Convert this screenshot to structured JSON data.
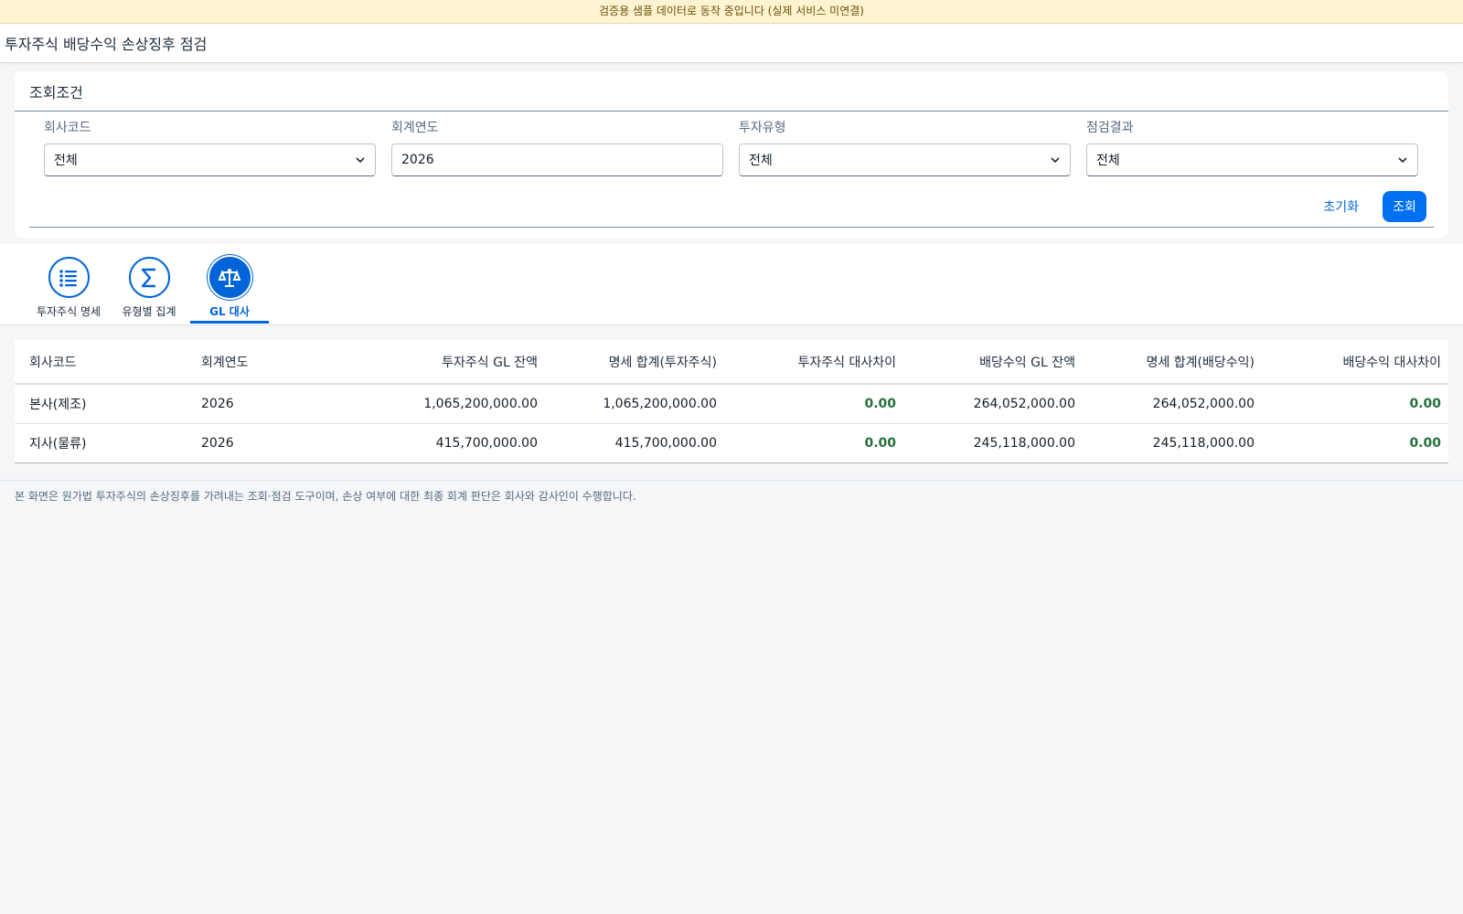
{
  "banner": "검증용 샘플 데이터로 동작 중입니다 (실제 서비스 미연결)",
  "page_title": "투자주식 배당수익 손상징후 점검",
  "filter": {
    "title": "조회조건",
    "fields": [
      {
        "label": "회사코드",
        "value": "전체",
        "type": "select"
      },
      {
        "label": "회계연도",
        "value": "2026",
        "type": "input"
      },
      {
        "label": "투자유형",
        "value": "전체",
        "type": "select"
      },
      {
        "label": "점검결과",
        "value": "전체",
        "type": "select"
      }
    ],
    "reset_label": "초기화",
    "search_label": "조회"
  },
  "tabs": [
    {
      "label": "투자주식 명세",
      "icon": "list-icon"
    },
    {
      "label": "유형별 집계",
      "icon": "sum-icon"
    },
    {
      "label": "GL 대사",
      "icon": "balance-scale-icon",
      "active": true
    }
  ],
  "table": {
    "headers": [
      "회사코드",
      "회계연도",
      "투자주식 GL 잔액",
      "명세 합계(투자주식)",
      "투자주식 대사차이",
      "배당수익 GL 잔액",
      "명세 합계(배당수익)",
      "배당수익 대사차이"
    ],
    "rows": [
      [
        "본사(제조)",
        "2026",
        "1,065,200,000.00",
        "1,065,200,000.00",
        "0.00",
        "264,052,000.00",
        "264,052,000.00",
        "0.00"
      ],
      [
        "지사(물류)",
        "2026",
        "415,700,000.00",
        "415,700,000.00",
        "0.00",
        "245,118,000.00",
        "245,118,000.00",
        "0.00"
      ]
    ]
  },
  "footnote": "본 화면은 원가법 투자주식의 손상징후를 가려내는 조회·점검 도구이며, 손상 여부에 대한 최종 회계 판단은 회사와 감사인이 수행합니다.",
  "colors": {
    "accent": "#0064d9",
    "button": "#0070f2",
    "positive": "#256f3a",
    "banner_bg": "#fff4d2"
  }
}
